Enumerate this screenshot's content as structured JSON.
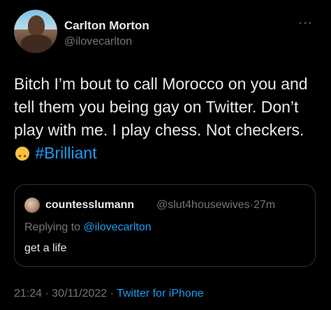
{
  "author": {
    "display_name": "Carlton Morton",
    "handle": "@ilovecarlton"
  },
  "more_icon": "more-horizontal-icon",
  "tweet": {
    "text_before_emoji": "Bitch I’m bout to call Morocco on you and tell them you being gay on Twitter. Don’t play with me. I play chess. Not checkers.",
    "emoji": "upside-down-face-emoji",
    "hashtag": "#Brilliant"
  },
  "quoted_tweet": {
    "display_name": "countesslumann",
    "handle": "@slut4housewives",
    "separator": "·",
    "time": "27m",
    "replying_prefix": "Replying to",
    "replying_to": "@ilovecarlton",
    "text": "get a life"
  },
  "meta": {
    "time": "21:24",
    "sep1": "·",
    "date": "30/11/2022",
    "sep2": "·",
    "source": "Twitter for iPhone"
  },
  "colors": {
    "background": "#000000",
    "text": "#e7e9ea",
    "secondary": "#71767b",
    "accent": "#1d9bf0",
    "border": "#2f3336"
  }
}
